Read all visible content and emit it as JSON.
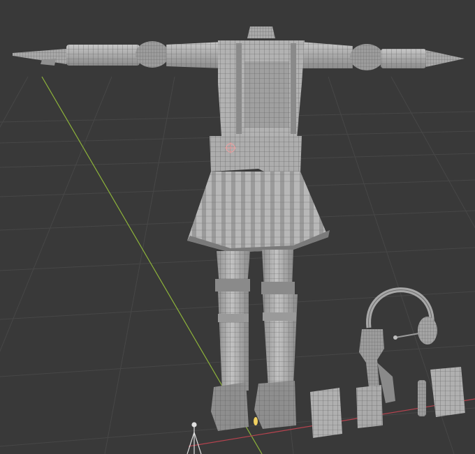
{
  "viewport": {
    "background": "#393939",
    "grid_color": "#4a4a4a",
    "y_axis_color": "#8db33a",
    "x_axis_color": "#b8434f"
  },
  "model": {
    "base_color": "#b4b4b4",
    "shade_color": "#8d8d8d",
    "dark_color": "#6f6f6f",
    "wire_color": "#5a5a5a"
  },
  "origin_marker_color": "#e8a0a0",
  "selected_origin_color": "#f0d060"
}
